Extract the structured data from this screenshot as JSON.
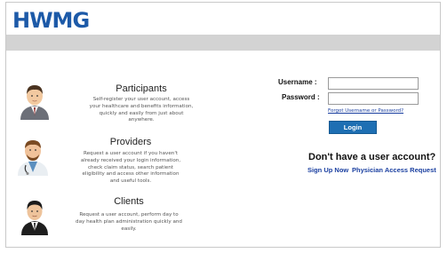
{
  "header": {
    "logo_text": "HWMG"
  },
  "personas": [
    {
      "title": "Participants",
      "icon": "businessman-icon",
      "description": "Self-register your user account, access your healthcare and benefits information, quickly and easily from just about anywhere."
    },
    {
      "title": "Providers",
      "icon": "doctor-icon",
      "description": "Request a user account if you haven't already received your login information, check claim status, search patient eligibility and access other information and useful tools."
    },
    {
      "title": "Clients",
      "icon": "executive-icon",
      "description": "Request a user account, perform day to day health plan administration quickly and easily."
    }
  ],
  "login": {
    "username_label": "Username :",
    "password_label": "Password :",
    "username_value": "",
    "password_value": "",
    "forgot_link": "Forgot Username or Password?",
    "login_button": "Login"
  },
  "signup": {
    "heading": "Don't have a user account?",
    "sign_up_link": "Sign Up Now",
    "physician_link": "Physician Access Request"
  }
}
